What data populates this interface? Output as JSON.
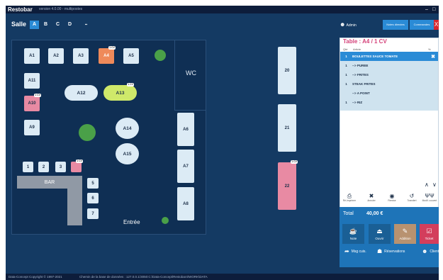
{
  "titlebar": {
    "app_name": "Restobar",
    "version": "version 4.0.00 - multipostes",
    "minimize": "–",
    "maximize": "□"
  },
  "floor": {
    "salle_label": "Salle",
    "tabs": [
      "A",
      "B",
      "C",
      "D"
    ],
    "active_tab": "A",
    "grid_icon": "▪▪",
    "wc_label": "WC",
    "bar_label": "BAR",
    "entree_label": "Entrée",
    "tables": {
      "A1": "A1",
      "A2": "A2",
      "A3": "A3",
      "A4": "A4",
      "A5": "A5",
      "A11": "A11",
      "A10": "A10",
      "A9": "A9",
      "A12": "A12",
      "A13": "A13",
      "A14": "A14",
      "A15": "A15",
      "A6": "A6",
      "A7": "A7",
      "A8": "A8",
      "T20": "20",
      "T21": "21",
      "T22": "22",
      "B1": "1",
      "B2": "2",
      "B3": "3",
      "B5": "5",
      "B6": "6",
      "B7": "7"
    },
    "badges": {
      "A4": "1 CV",
      "A10": "1 CV",
      "A13": "1 CV",
      "B4": "1 CV",
      "T22": "1 CV"
    }
  },
  "header": {
    "user": "Admin",
    "btn_notes": "Notes directes",
    "btn_commandes": "Commandes",
    "close": "X"
  },
  "order": {
    "title": "Table : A4 / 1 CV",
    "col_qty": "Qté",
    "col_article": "Article",
    "col_pct": "%",
    "lines": [
      {
        "qty": "1",
        "article": "BOULETTES SAUCE TOMATE"
      },
      {
        "qty": "1",
        "article": "--> PUREE"
      },
      {
        "qty": "1",
        "article": "--> FRITES"
      },
      {
        "qty": "1",
        "article": "STEAK FRITES"
      },
      {
        "qty": "",
        "article": "--> A POINT"
      },
      {
        "qty": "1",
        "article": "--> RIZ"
      }
    ],
    "delete_icon": "✖",
    "scroll_up": "∧",
    "scroll_down": "∨"
  },
  "tools": [
    {
      "icon": "printer-icon",
      "glyph": "⎙",
      "label": "Ré-imprimer"
    },
    {
      "icon": "cancel-icon",
      "glyph": "✖",
      "label": "Annuler"
    },
    {
      "icon": "remise-icon",
      "glyph": "◉",
      "label": "Remise"
    },
    {
      "icon": "transfer-icon",
      "glyph": "↺",
      "label": "Transfert"
    },
    {
      "icon": "cutlery-icon",
      "glyph": "ΨΨ",
      "label": "Modif. couvert"
    }
  ],
  "totals": {
    "label": "Total",
    "value": "40,00 €"
  },
  "actions": [
    {
      "label": "Note",
      "glyph": "☕",
      "color": "#1a5f95"
    },
    {
      "label": "Ouvrir",
      "glyph": "⏏",
      "color": "#1a5f95"
    },
    {
      "label": "Addition",
      "glyph": "✎",
      "color": "#b89270"
    },
    {
      "label": "Ticket",
      "glyph": "☑",
      "color": "#d33e5c"
    }
  ],
  "links": [
    {
      "label": "Msg cuis.",
      "glyph": "➦"
    },
    {
      "label": "Réservations",
      "glyph": "☗"
    },
    {
      "label": "Client",
      "glyph": "☻"
    }
  ],
  "footer": {
    "copyright": "Data-Concept Copyright © 1997-2021",
    "db_path": "Chemin de la base de données : 127.0.0.1/3050:C:\\Data-Concept\\Restobar4\\WORK\\DATA"
  },
  "colors": {
    "background": "#143a63",
    "accent": "#2a8bd6",
    "occupied": "#ef8a5a",
    "pink": "#e88aa3",
    "green_table": "#cfe96a",
    "close_red": "#d8262f",
    "order_title": "#d4427a"
  }
}
